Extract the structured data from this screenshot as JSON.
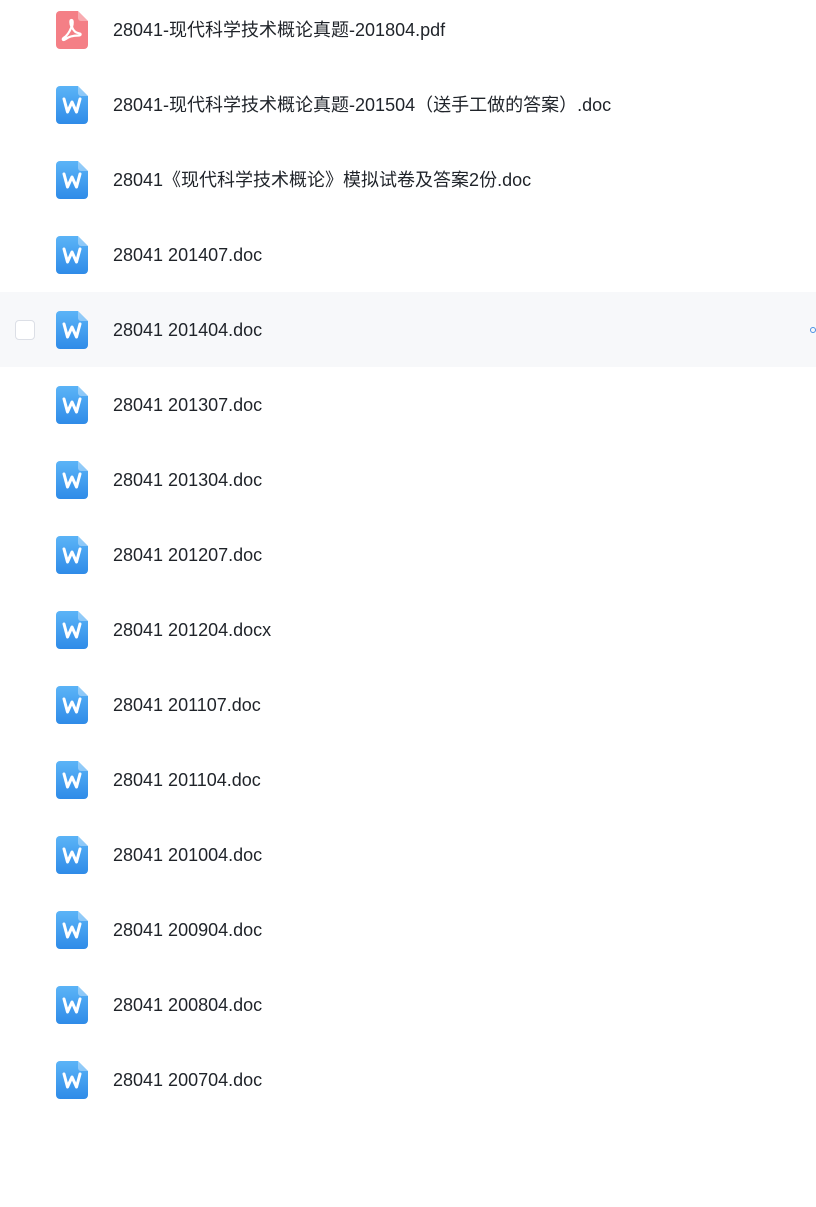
{
  "colors": {
    "pdf_icon": "#f47f86",
    "doc_icon_top": "#5bb4f7",
    "doc_icon_bottom": "#2f8be8",
    "hover_row_bg": "#f7f8fa",
    "text": "#1f2329"
  },
  "files": [
    {
      "name": "28041-现代科学技术概论真题-201804.pdf",
      "icon": "pdf-icon",
      "hovered": false
    },
    {
      "name": "28041-现代科学技术概论真题-201504（送手工做的答案）.doc",
      "icon": "word-doc-icon",
      "hovered": false
    },
    {
      "name": "28041《现代科学技术概论》模拟试卷及答案2份.doc",
      "icon": "word-doc-icon",
      "hovered": false
    },
    {
      "name": "28041 201407.doc",
      "icon": "word-doc-icon",
      "hovered": false
    },
    {
      "name": "28041 201404.doc",
      "icon": "word-doc-icon",
      "hovered": true
    },
    {
      "name": "28041 201307.doc",
      "icon": "word-doc-icon",
      "hovered": false
    },
    {
      "name": "28041 201304.doc",
      "icon": "word-doc-icon",
      "hovered": false
    },
    {
      "name": "28041 201207.doc",
      "icon": "word-doc-icon",
      "hovered": false
    },
    {
      "name": "28041 201204.docx",
      "icon": "word-doc-icon",
      "hovered": false
    },
    {
      "name": "28041 201107.doc",
      "icon": "word-doc-icon",
      "hovered": false
    },
    {
      "name": "28041 201104.doc",
      "icon": "word-doc-icon",
      "hovered": false
    },
    {
      "name": "28041 201004.doc",
      "icon": "word-doc-icon",
      "hovered": false
    },
    {
      "name": "28041 200904.doc",
      "icon": "word-doc-icon",
      "hovered": false
    },
    {
      "name": "28041 200804.doc",
      "icon": "word-doc-icon",
      "hovered": false
    },
    {
      "name": "28041 200704.doc",
      "icon": "word-doc-icon",
      "hovered": false
    }
  ]
}
